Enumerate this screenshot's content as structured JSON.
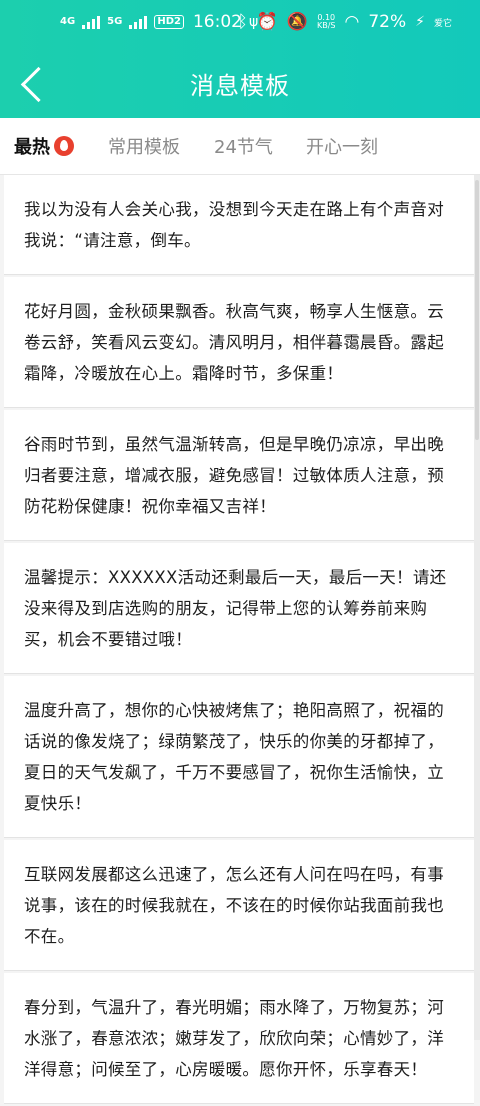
{
  "status_bar": {
    "net1": "4G",
    "net2": "5G",
    "hd": "HD2",
    "time": "16:02",
    "speed_value": "0.10",
    "speed_unit": "KB/S",
    "battery": "72%",
    "carrier": "爱它"
  },
  "header": {
    "title": "消息模板"
  },
  "tabs": [
    {
      "label": "最热"
    },
    {
      "label": "常用模板"
    },
    {
      "label": "24节气"
    },
    {
      "label": "开心一刻"
    }
  ],
  "messages": [
    {
      "text": "我以为没有人会关心我，没想到今天走在路上有个声音对我说：“请注意，倒车。"
    },
    {
      "text": "花好月圆，金秋硕果飘香。秋高气爽，畅享人生惬意。云卷云舒，笑看风云变幻。清风明月，相伴暮霭晨昏。露起霜降，冷暖放在心上。霜降时节，多保重！"
    },
    {
      "text": "谷雨时节到，虽然气温渐转高，但是早晚仍凉凉，早出晚归者要注意，增减衣服，避免感冒！过敏体质人注意，预防花粉保健康！祝你幸福又吉祥！"
    },
    {
      "text": "温馨提示：XXXXXX活动还剩最后一天，最后一天！请还没来得及到店选购的朋友，记得带上您的认筹券前来购买，机会不要错过哦！"
    },
    {
      "text": "温度升高了，想你的心快被烤焦了；艳阳高照了，祝福的话说的像发烧了；绿荫繁茂了，快乐的你美的牙都掉了，夏日的天气发飙了，千万不要感冒了，祝你生活愉快，立夏快乐！"
    },
    {
      "text": "互联网发展都这么迅速了，怎么还有人问在吗在吗，有事说事，该在的时候我就在，不该在的时候你站我面前我也不在。"
    },
    {
      "text": "春分到，气温升了，春光明媚；雨水降了，万物复苏；河水涨了，春意浓浓；嫩芽发了，欣欣向荣；心情妙了，洋洋得意；问候至了，心房暖暖。愿你开怀，乐享春天！"
    }
  ],
  "colors": {
    "header_start": "#1ccfae",
    "header_end": "#13c9bb",
    "hot_icon": "#e8402e"
  }
}
